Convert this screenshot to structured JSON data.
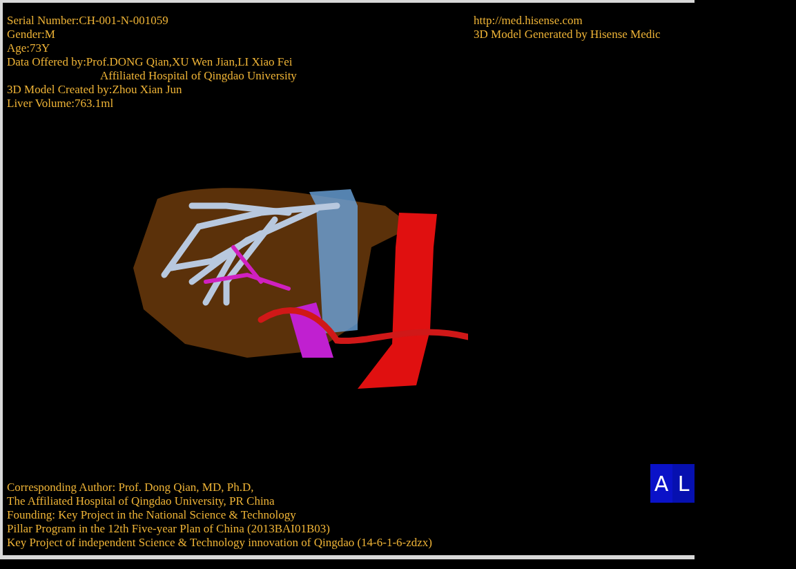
{
  "patient_info": [
    "Serial Number:CH-001-N-001059",
    "Gender:M",
    "Age:73Y",
    "Data Offered by:Prof.DONG Qian,XU Wen Jian,LI Xiao Fei",
    "Affiliated Hospital of Qingdao University",
    "3D Model Created by:Zhou Xian Jun",
    "Liver Volume:763.1ml"
  ],
  "generator_info": [
    "http://med.hisense.com",
    "3D Model Generated by Hisense Medic"
  ],
  "credits": [
    "Corresponding Author: Prof. Dong Qian, MD, Ph.D,",
    "The Affiliated Hospital of Qingdao University, PR China",
    "Founding: Key Project in the National Science & Technology",
    "Pillar Program in the 12th Five-year Plan of China (2013BAI01B03)",
    "Key Project of independent Science & Technology innovation of Qingdao (14-6-1-6-zdzx)"
  ],
  "orientation_cube": {
    "faces": [
      "A",
      "L"
    ]
  }
}
